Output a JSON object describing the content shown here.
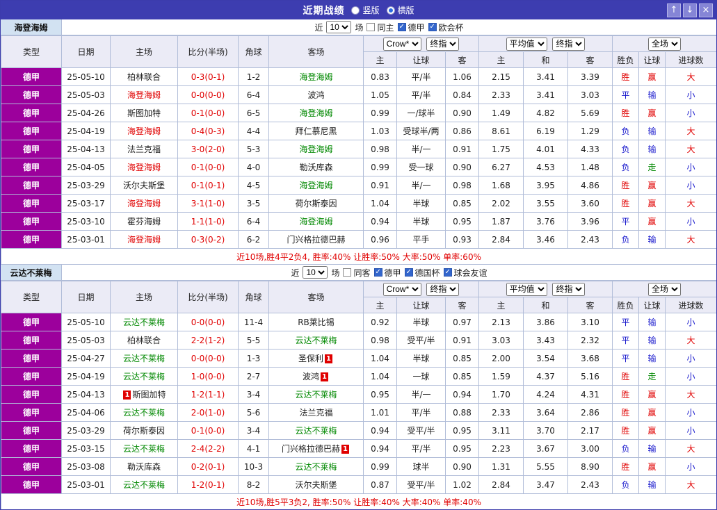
{
  "titlebar": {
    "title": "近期战绩",
    "vertical_label": "竖版",
    "horizontal_label": "横版",
    "up_glyph": "↑",
    "down_glyph": "↓",
    "close_glyph": "×"
  },
  "filter": {
    "near": "近",
    "count": "10",
    "games": "场"
  },
  "dropdowns": {
    "book": "Crow*",
    "final": "终指",
    "avg": "平均值",
    "scope": "全场"
  },
  "columns": {
    "type": "类型",
    "date": "日期",
    "home": "主场",
    "score": "比分(半场)",
    "corner": "角球",
    "away": "客场",
    "odds_home": "主",
    "odds_line": "让球",
    "odds_away": "客",
    "avg_home": "主",
    "avg_draw": "和",
    "avg_away": "客",
    "result_wdl": "胜负",
    "result_handicap": "让球",
    "result_goals": "进球数"
  },
  "colors": {
    "titlebar": "#3d3db0",
    "league_cell": "#9c009c",
    "win_red": "#e00000",
    "lose_blue": "#1515cc",
    "push_green": "#008800",
    "home_team_red": "#e00000",
    "away_team_green": "#008800"
  },
  "sections": [
    {
      "team": "海登海姆",
      "filters": [
        {
          "label": "同主",
          "checked": false
        },
        {
          "label": "德甲",
          "checked": true
        },
        {
          "label": "欧会杯",
          "checked": true
        }
      ],
      "rows": [
        [
          "德甲",
          "25-05-10",
          [
            "柏林联合",
            "",
            0
          ],
          "0-3(0-1)",
          "1-2",
          [
            "海登海姆",
            "g",
            0
          ],
          "0.83",
          "平/半",
          "1.06",
          "2.15",
          "3.41",
          "3.39",
          [
            "胜",
            "r"
          ],
          [
            "赢",
            "r"
          ],
          [
            "大",
            "r"
          ]
        ],
        [
          "德甲",
          "25-05-03",
          [
            "海登海姆",
            "r",
            0
          ],
          "0-0(0-0)",
          "6-4",
          [
            "波鸿",
            "",
            0
          ],
          "1.05",
          "平/半",
          "0.84",
          "2.33",
          "3.41",
          "3.03",
          [
            "平",
            "b"
          ],
          [
            "输",
            "b"
          ],
          [
            "小",
            "b"
          ]
        ],
        [
          "德甲",
          "25-04-26",
          [
            "斯图加特",
            "",
            0
          ],
          "0-1(0-0)",
          "6-5",
          [
            "海登海姆",
            "g",
            0
          ],
          "0.99",
          "一/球半",
          "0.90",
          "1.49",
          "4.82",
          "5.69",
          [
            "胜",
            "r"
          ],
          [
            "赢",
            "r"
          ],
          [
            "小",
            "b"
          ]
        ],
        [
          "德甲",
          "25-04-19",
          [
            "海登海姆",
            "r",
            0
          ],
          "0-4(0-3)",
          "4-4",
          [
            "拜仁慕尼黑",
            "",
            0
          ],
          "1.03",
          "受球半/两",
          "0.86",
          "8.61",
          "6.19",
          "1.29",
          [
            "负",
            "b"
          ],
          [
            "输",
            "b"
          ],
          [
            "大",
            "r"
          ]
        ],
        [
          "德甲",
          "25-04-13",
          [
            "法兰克福",
            "",
            0
          ],
          "3-0(2-0)",
          "5-3",
          [
            "海登海姆",
            "g",
            0
          ],
          "0.98",
          "半/一",
          "0.91",
          "1.75",
          "4.01",
          "4.33",
          [
            "负",
            "b"
          ],
          [
            "输",
            "b"
          ],
          [
            "大",
            "r"
          ]
        ],
        [
          "德甲",
          "25-04-05",
          [
            "海登海姆",
            "r",
            0
          ],
          "0-1(0-0)",
          "4-0",
          [
            "勒沃库森",
            "",
            0
          ],
          "0.99",
          "受一球",
          "0.90",
          "6.27",
          "4.53",
          "1.48",
          [
            "负",
            "b"
          ],
          [
            "走",
            "g"
          ],
          [
            "小",
            "b"
          ]
        ],
        [
          "德甲",
          "25-03-29",
          [
            "沃尔夫斯堡",
            "",
            0
          ],
          "0-1(0-1)",
          "4-5",
          [
            "海登海姆",
            "g",
            0
          ],
          "0.91",
          "半/一",
          "0.98",
          "1.68",
          "3.95",
          "4.86",
          [
            "胜",
            "r"
          ],
          [
            "赢",
            "r"
          ],
          [
            "小",
            "b"
          ]
        ],
        [
          "德甲",
          "25-03-17",
          [
            "海登海姆",
            "r",
            0
          ],
          "3-1(1-0)",
          "3-5",
          [
            "荷尔斯泰因",
            "",
            0
          ],
          "1.04",
          "半球",
          "0.85",
          "2.02",
          "3.55",
          "3.60",
          [
            "胜",
            "r"
          ],
          [
            "赢",
            "r"
          ],
          [
            "大",
            "r"
          ]
        ],
        [
          "德甲",
          "25-03-10",
          [
            "霍芬海姆",
            "",
            0
          ],
          "1-1(1-0)",
          "6-4",
          [
            "海登海姆",
            "g",
            0
          ],
          "0.94",
          "半球",
          "0.95",
          "1.87",
          "3.76",
          "3.96",
          [
            "平",
            "b"
          ],
          [
            "赢",
            "r"
          ],
          [
            "小",
            "b"
          ]
        ],
        [
          "德甲",
          "25-03-01",
          [
            "海登海姆",
            "r",
            0
          ],
          "0-3(0-2)",
          "6-2",
          [
            "门兴格拉德巴赫",
            "",
            0
          ],
          "0.96",
          "平手",
          "0.93",
          "2.84",
          "3.46",
          "2.43",
          [
            "负",
            "b"
          ],
          [
            "输",
            "b"
          ],
          [
            "大",
            "r"
          ]
        ]
      ],
      "summary": "近10场,胜4平2负4, 胜率:40% 让胜率:50% 大率:50% 单率:60%"
    },
    {
      "team": "云达不莱梅",
      "filters": [
        {
          "label": "同客",
          "checked": false
        },
        {
          "label": "德甲",
          "checked": true
        },
        {
          "label": "德国杯",
          "checked": true
        },
        {
          "label": "球会友谊",
          "checked": true
        }
      ],
      "rows": [
        [
          "德甲",
          "25-05-10",
          [
            "云达不莱梅",
            "g",
            0
          ],
          "0-0(0-0)",
          "11-4",
          [
            "RB莱比锡",
            "",
            0
          ],
          "0.92",
          "半球",
          "0.97",
          "2.13",
          "3.86",
          "3.10",
          [
            "平",
            "b"
          ],
          [
            "输",
            "b"
          ],
          [
            "小",
            "b"
          ]
        ],
        [
          "德甲",
          "25-05-03",
          [
            "柏林联合",
            "",
            0
          ],
          "2-2(1-2)",
          "5-5",
          [
            "云达不莱梅",
            "g",
            0
          ],
          "0.98",
          "受平/半",
          "0.91",
          "3.03",
          "3.43",
          "2.32",
          [
            "平",
            "b"
          ],
          [
            "输",
            "b"
          ],
          [
            "大",
            "r"
          ]
        ],
        [
          "德甲",
          "25-04-27",
          [
            "云达不莱梅",
            "g",
            0
          ],
          "0-0(0-0)",
          "1-3",
          [
            "圣保利",
            "",
            1
          ],
          "1.04",
          "半球",
          "0.85",
          "2.00",
          "3.54",
          "3.68",
          [
            "平",
            "b"
          ],
          [
            "输",
            "b"
          ],
          [
            "小",
            "b"
          ]
        ],
        [
          "德甲",
          "25-04-19",
          [
            "云达不莱梅",
            "g",
            0
          ],
          "1-0(0-0)",
          "2-7",
          [
            "波鸿",
            "",
            1
          ],
          "1.04",
          "一球",
          "0.85",
          "1.59",
          "4.37",
          "5.16",
          [
            "胜",
            "r"
          ],
          [
            "走",
            "g"
          ],
          [
            "小",
            "b"
          ]
        ],
        [
          "德甲",
          "25-04-13",
          [
            "斯图加特",
            "",
            1
          ],
          "1-2(1-1)",
          "3-4",
          [
            "云达不莱梅",
            "g",
            0
          ],
          "0.95",
          "半/一",
          "0.94",
          "1.70",
          "4.24",
          "4.31",
          [
            "胜",
            "r"
          ],
          [
            "赢",
            "r"
          ],
          [
            "大",
            "r"
          ]
        ],
        [
          "德甲",
          "25-04-06",
          [
            "云达不莱梅",
            "g",
            0
          ],
          "2-0(1-0)",
          "5-6",
          [
            "法兰克福",
            "",
            0
          ],
          "1.01",
          "平/半",
          "0.88",
          "2.33",
          "3.64",
          "2.86",
          [
            "胜",
            "r"
          ],
          [
            "赢",
            "r"
          ],
          [
            "小",
            "b"
          ]
        ],
        [
          "德甲",
          "25-03-29",
          [
            "荷尔斯泰因",
            "",
            0
          ],
          "0-1(0-0)",
          "3-4",
          [
            "云达不莱梅",
            "g",
            0
          ],
          "0.94",
          "受平/半",
          "0.95",
          "3.11",
          "3.70",
          "2.17",
          [
            "胜",
            "r"
          ],
          [
            "赢",
            "r"
          ],
          [
            "小",
            "b"
          ]
        ],
        [
          "德甲",
          "25-03-15",
          [
            "云达不莱梅",
            "g",
            0
          ],
          "2-4(2-2)",
          "4-1",
          [
            "门兴格拉德巴赫",
            "",
            1
          ],
          "0.94",
          "平/半",
          "0.95",
          "2.23",
          "3.67",
          "3.00",
          [
            "负",
            "b"
          ],
          [
            "输",
            "b"
          ],
          [
            "大",
            "r"
          ]
        ],
        [
          "德甲",
          "25-03-08",
          [
            "勒沃库森",
            "",
            0
          ],
          "0-2(0-1)",
          "10-3",
          [
            "云达不莱梅",
            "g",
            0
          ],
          "0.99",
          "球半",
          "0.90",
          "1.31",
          "5.55",
          "8.90",
          [
            "胜",
            "r"
          ],
          [
            "赢",
            "r"
          ],
          [
            "小",
            "b"
          ]
        ],
        [
          "德甲",
          "25-03-01",
          [
            "云达不莱梅",
            "g",
            0
          ],
          "1-2(0-1)",
          "8-2",
          [
            "沃尔夫斯堡",
            "",
            0
          ],
          "0.87",
          "受平/半",
          "1.02",
          "2.84",
          "3.47",
          "2.43",
          [
            "负",
            "b"
          ],
          [
            "输",
            "b"
          ],
          [
            "大",
            "r"
          ]
        ]
      ],
      "summary": "近10场,胜5平3负2, 胜率:50% 让胜率:40% 大率:40% 单率:40%"
    }
  ]
}
